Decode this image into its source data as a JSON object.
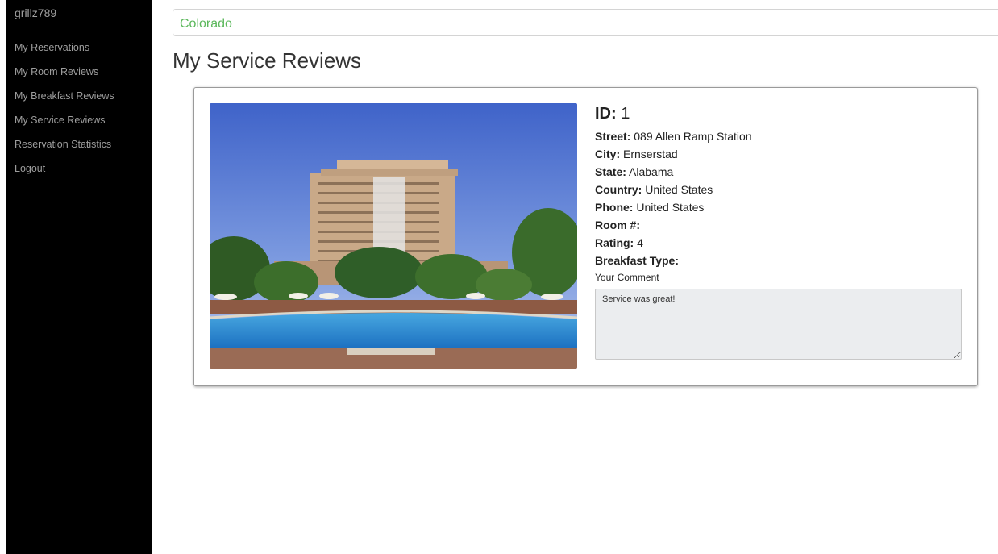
{
  "sidebar": {
    "username": "grillz789",
    "items": [
      {
        "label": "My Reservations"
      },
      {
        "label": "My Room Reviews"
      },
      {
        "label": "My Breakfast Reviews"
      },
      {
        "label": "My Service Reviews"
      },
      {
        "label": "Reservation Statistics"
      },
      {
        "label": "Logout"
      }
    ]
  },
  "location_bar": {
    "value": "Colorado"
  },
  "page": {
    "title": "My Service Reviews"
  },
  "review": {
    "id_label": "ID:",
    "id_value": "1",
    "fields": [
      {
        "label": "Street:",
        "value": "089 Allen Ramp Station"
      },
      {
        "label": "City:",
        "value": "Ernserstad"
      },
      {
        "label": "State:",
        "value": "Alabama"
      },
      {
        "label": "Country:",
        "value": "United States"
      },
      {
        "label": "Phone:",
        "value": "United States"
      },
      {
        "label": "Room #:",
        "value": ""
      },
      {
        "label": "Rating:",
        "value": "4"
      },
      {
        "label": "Breakfast Type:",
        "value": ""
      }
    ],
    "comment_label": "Your Comment",
    "comment": "Service was great!"
  },
  "colors": {
    "sidebar_bg": "#000000",
    "location_text": "#5cb85c",
    "comment_bg": "#ebedef"
  }
}
